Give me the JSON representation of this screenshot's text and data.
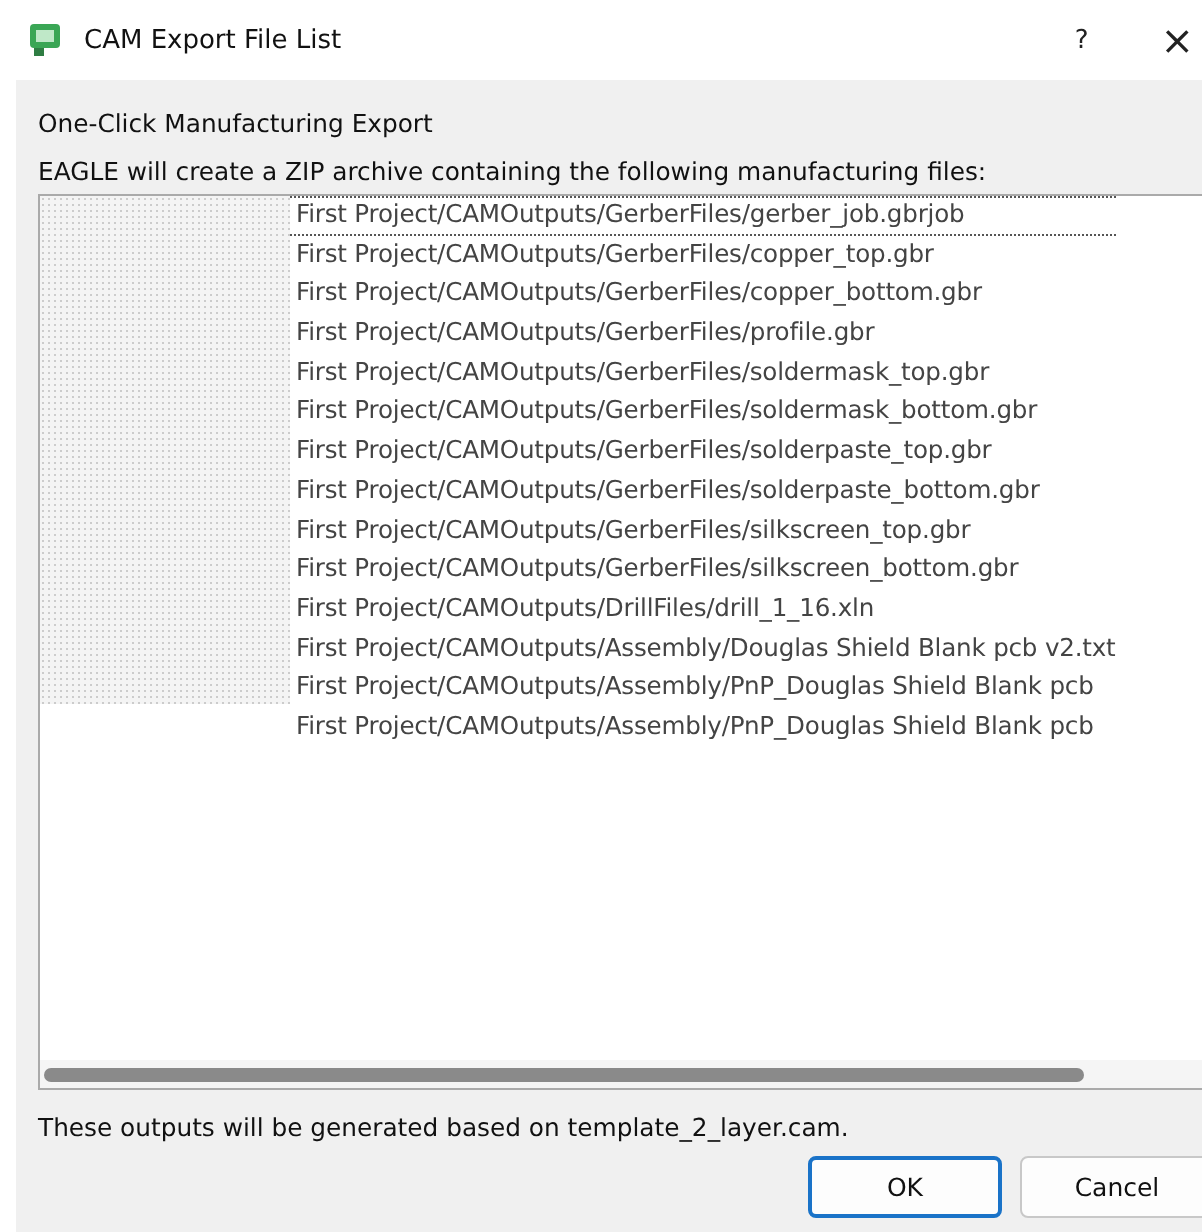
{
  "window": {
    "title": "CAM Export File List",
    "help": "?",
    "close": "×"
  },
  "heading": "One-Click Manufacturing Export",
  "description": "EAGLE will create a ZIP archive containing the following manufacturing files:",
  "files": [
    {
      "path": "First Project/CAMOutputs/GerberFiles/gerber_job.gbrjob",
      "focused": true
    },
    {
      "path": "First Project/CAMOutputs/GerberFiles/copper_top.gbr",
      "focused": false
    },
    {
      "path": "First Project/CAMOutputs/GerberFiles/copper_bottom.gbr",
      "focused": false
    },
    {
      "path": "First Project/CAMOutputs/GerberFiles/profile.gbr",
      "focused": false
    },
    {
      "path": "First Project/CAMOutputs/GerberFiles/soldermask_top.gbr",
      "focused": false
    },
    {
      "path": "First Project/CAMOutputs/GerberFiles/soldermask_bottom.gbr",
      "focused": false
    },
    {
      "path": "First Project/CAMOutputs/GerberFiles/solderpaste_top.gbr",
      "focused": false
    },
    {
      "path": "First Project/CAMOutputs/GerberFiles/solderpaste_bottom.gbr",
      "focused": false
    },
    {
      "path": "First Project/CAMOutputs/GerberFiles/silkscreen_top.gbr",
      "focused": false
    },
    {
      "path": "First Project/CAMOutputs/GerberFiles/silkscreen_bottom.gbr",
      "focused": false
    },
    {
      "path": "First Project/CAMOutputs/DrillFiles/drill_1_16.xln",
      "focused": false
    },
    {
      "path": "First Project/CAMOutputs/Assembly/Douglas Shield Blank pcb v2.txt",
      "focused": false
    },
    {
      "path": "First Project/CAMOutputs/Assembly/PnP_Douglas Shield Blank pcb",
      "focused": false
    },
    {
      "path": "First Project/CAMOutputs/Assembly/PnP_Douglas Shield Blank pcb",
      "focused": false
    }
  ],
  "footer": "These outputs will be generated based on template_2_layer.cam.",
  "buttons": [
    {
      "label": "OK",
      "default": true
    },
    {
      "label": "Cancel",
      "default": false
    }
  ]
}
